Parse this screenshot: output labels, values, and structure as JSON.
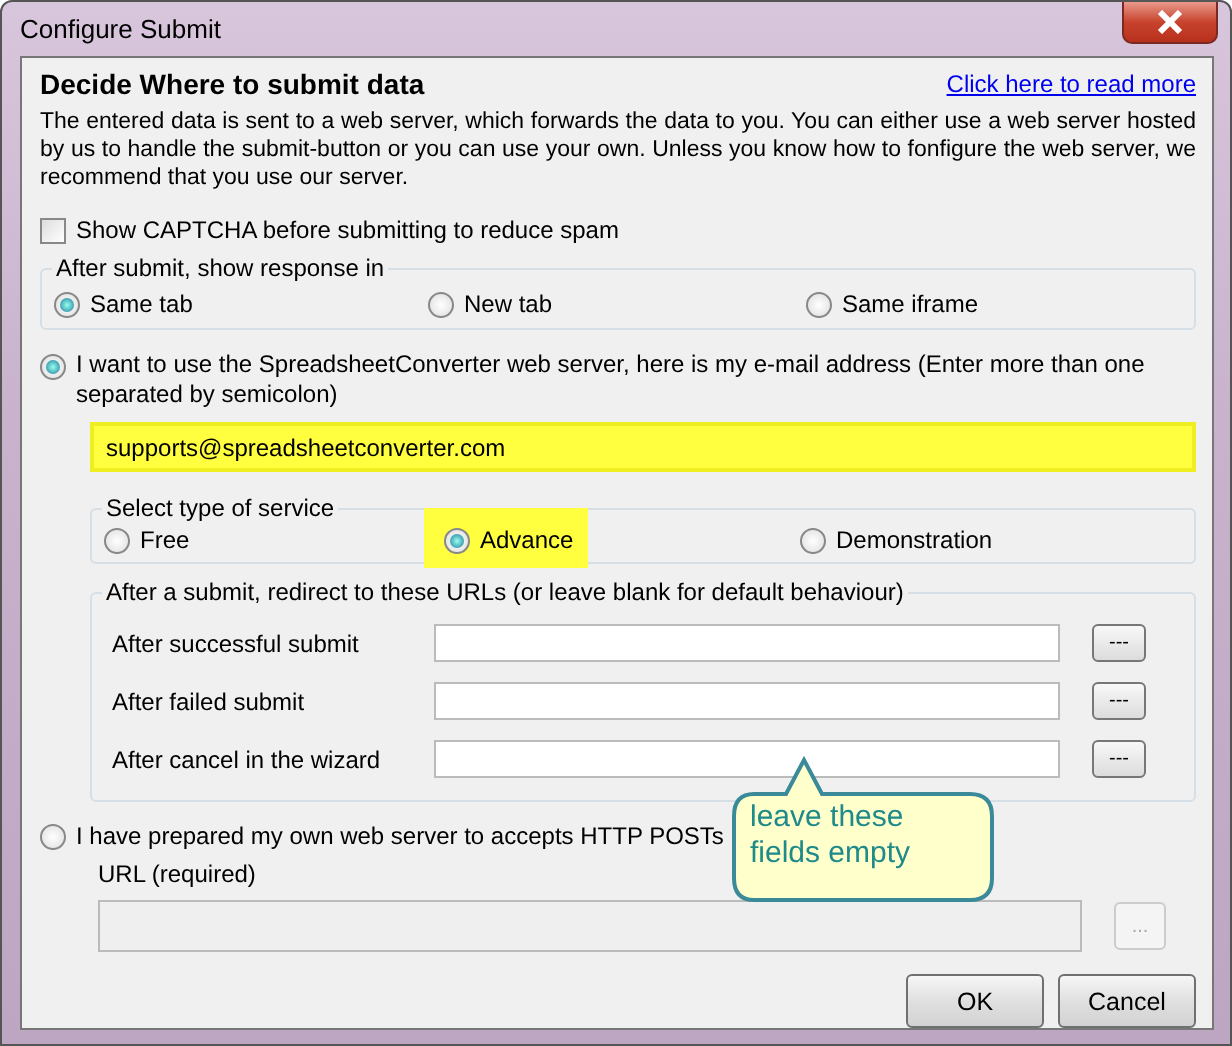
{
  "window": {
    "title": "Configure Submit"
  },
  "header": {
    "title": "Decide Where to submit data",
    "link": "Click here to read more"
  },
  "description": "The entered data is sent to a web server, which forwards the data to you. You can either use a web server hosted by us to handle the submit-button or you can use your own. Unless you know how to fonfigure the web server, we recommend that you use our server.",
  "captcha": {
    "label": "Show CAPTCHA before submitting to reduce spam",
    "checked": false
  },
  "response_group": {
    "label": "After submit, show response in",
    "options": [
      {
        "label": "Same tab",
        "selected": true
      },
      {
        "label": "New tab",
        "selected": false
      },
      {
        "label": "Same iframe",
        "selected": false
      }
    ]
  },
  "hosted_server": {
    "label": "I want to use the SpreadsheetConverter web server, here is my e-mail address (Enter more than one separated by semicolon)",
    "selected": true,
    "email": {
      "value": "supports@spreadsheetconverter.com",
      "highlighted": true
    },
    "service_group": {
      "label": "Select type of service",
      "options": [
        {
          "label": "Free",
          "selected": false,
          "highlighted": false
        },
        {
          "label": "Advance",
          "selected": true,
          "highlighted": true
        },
        {
          "label": "Demonstration",
          "selected": false,
          "highlighted": false
        }
      ]
    },
    "redirect_group": {
      "label": "After a submit, redirect to these URLs (or leave blank for default behaviour)",
      "rows": [
        {
          "label": "After successful submit",
          "button": "---"
        },
        {
          "label": "After failed submit",
          "button": "---"
        },
        {
          "label": "After cancel in the wizard",
          "button": "---"
        }
      ]
    }
  },
  "own_server": {
    "label": "I have prepared my own web server to accepts HTTP POSTs",
    "selected": false,
    "url_label": "URL (required)",
    "disabled": true,
    "button": "..."
  },
  "callout": {
    "text": "leave these fields empty"
  },
  "buttons": [
    "OK",
    "Cancel"
  ]
}
